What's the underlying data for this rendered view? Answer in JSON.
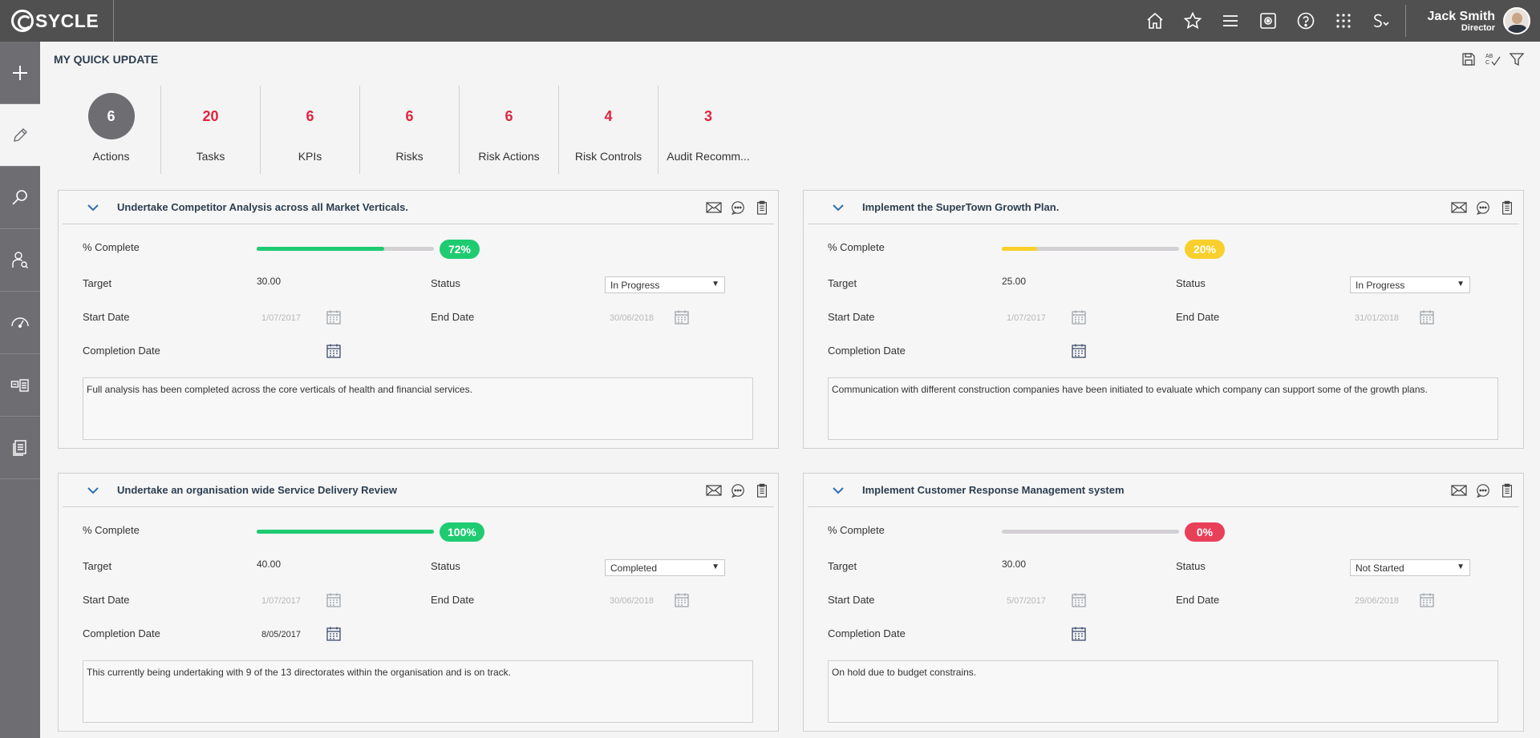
{
  "app": {
    "logo_text": "SYCLE"
  },
  "user": {
    "name": "Jack Smith",
    "role": "Director"
  },
  "top_icons": [
    "home-icon",
    "star-icon",
    "menu-icon",
    "settings-box-icon",
    "help-icon",
    "apps-grid-icon",
    "language-icon"
  ],
  "page": {
    "title": "MY QUICK UPDATE"
  },
  "stats": [
    {
      "value": "6",
      "label": "Actions"
    },
    {
      "value": "20",
      "label": "Tasks"
    },
    {
      "value": "6",
      "label": "KPIs"
    },
    {
      "value": "6",
      "label": "Risks"
    },
    {
      "value": "6",
      "label": "Risk Actions"
    },
    {
      "value": "4",
      "label": "Risk Controls"
    },
    {
      "value": "3",
      "label": "Audit Recomm..."
    }
  ],
  "labels": {
    "percent_complete": "% Complete",
    "target": "Target",
    "status": "Status",
    "start_date": "Start Date",
    "end_date": "End Date",
    "completion_date": "Completion Date"
  },
  "colors": {
    "green": "#1ecb71",
    "yellow": "#f8cf2c",
    "red": "#e9405a",
    "track": "#d3d0d4"
  },
  "cards": [
    {
      "title": "Undertake Competitor Analysis across all Market Verticals.",
      "percent": 72,
      "percent_label": "72%",
      "color": "#1ecb71",
      "target": "30.00",
      "status": "In Progress",
      "start_date": "1/07/2017",
      "end_date": "30/06/2018",
      "completion_date": "",
      "notes": "Full analysis has been completed across the core verticals of health and financial services."
    },
    {
      "title": "Implement the SuperTown Growth Plan.",
      "percent": 20,
      "percent_label": "20%",
      "color": "#f8cf2c",
      "target": "25.00",
      "status": "In Progress",
      "start_date": "1/07/2017",
      "end_date": "31/01/2018",
      "completion_date": "",
      "notes": "Communication with different construction companies have been initiated to evaluate which company can support some of the growth plans."
    },
    {
      "title": "Undertake an organisation wide Service Delivery Review",
      "percent": 100,
      "percent_label": "100%",
      "color": "#1ecb71",
      "target": "40.00",
      "status": "Completed",
      "start_date": "1/07/2017",
      "end_date": "30/06/2018",
      "completion_date": "8/05/2017",
      "notes": "This currently being undertaking with 9 of the 13 directorates within the organisation and is on track."
    },
    {
      "title": "Implement Customer Response Management system",
      "percent": 0,
      "percent_label": "0%",
      "color": "#e9405a",
      "target": "30.00",
      "status": "Not Started",
      "start_date": "5/07/2017",
      "end_date": "29/06/2018",
      "completion_date": "",
      "notes": "On hold due to budget constrains."
    }
  ]
}
